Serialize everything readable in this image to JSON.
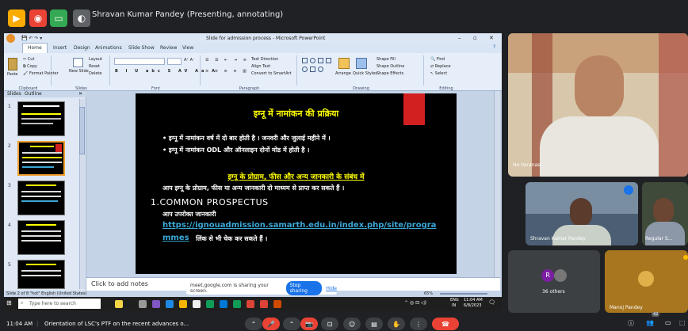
{
  "meet_top": {
    "presenter_status": "Shravan Kumar Pandey (Presenting, annotating)"
  },
  "ppt": {
    "window_title": "Slide for admission process - Microsoft PowerPoint",
    "tabs": [
      "Home",
      "Insert",
      "Design",
      "Animations",
      "Slide Show",
      "Review",
      "View"
    ],
    "ribbon": {
      "paste": "Paste",
      "cut": "Cut",
      "copy": "Copy",
      "format_painter": "Format Painter",
      "new_slide": "New Slide",
      "layout": "Layout",
      "reset": "Reset",
      "delete": "Delete",
      "text_direction": "Text Direction",
      "align_text": "Align Text",
      "convert_smartart": "Convert to SmartArt",
      "arrange": "Arrange",
      "quick_styles": "Quick Styles",
      "shape_fill": "Shape Fill",
      "shape_outline": "Shape Outline",
      "shape_effects": "Shape Effects",
      "find": "Find",
      "replace": "Replace",
      "select": "Select",
      "groups": {
        "clipboard": "Clipboard",
        "slides": "Slides",
        "font": "Font",
        "paragraph": "Paragraph",
        "drawing": "Drawing",
        "editing": "Editing"
      }
    },
    "pane_tabs": {
      "slides": "Slides",
      "outline": "Outline"
    },
    "thumb_numbers": [
      "1",
      "2",
      "3",
      "4",
      "5"
    ],
    "slide": {
      "heading1": "इग्नू में नामांकन की प्रक्रिया",
      "bullet1": "• इग्नू में नामांकन वर्ष में दो बार होती है । जनवरी और जुलाई महीने में ।",
      "bullet2": "• इग्नू में नामांकन ODL और ऑनलाइन दोनों मोड में होती है ।",
      "heading2": "इग्नू के प्रोग्राम, फीस और अन्य जानकारी के संबंध में",
      "para": "आप इग्नू के प्रोग्राम, फीस या अन्य जानकारी दो माध्यम से प्राप्त कर सकते हैं ।",
      "item1": "1.COMMON PROSPECTUS",
      "item1_sub": "आप उपरोक्त जानकारी",
      "url_line1": "https://ignouadmission.samarth.edu.in/index.php/site/progra",
      "url_line2": "mmes",
      "url_suffix": "लिंक से भी चेक कर सकते हैं ।",
      "colors": {
        "bg": "#000000",
        "yellow": "#ffff00",
        "red": "#d21f1f",
        "link": "#3aa7d6",
        "text": "#ffffff"
      }
    },
    "notes_placeholder": "Click to add notes",
    "status_left": "Slide 2 of 8   \"hot\"   English (United States)",
    "zoom": "65%"
  },
  "share_banner": {
    "text": "meet.google.com is sharing your screen.",
    "stop": "Stop sharing",
    "hide": "Hide"
  },
  "taskbar": {
    "search_placeholder": "Type here to search",
    "lang": "ENG",
    "lang_sub": "IN",
    "time": "11:04 AM",
    "date": "6/8/2023"
  },
  "participants": {
    "main_location": "Ho Varanasi",
    "tile1_name": "Shravan Kumar Pandey",
    "tile2_name": "Regular S...",
    "others_count": "36 others",
    "others_initial": "R",
    "manoj_name": "Manoj Pandey",
    "badge_count": "42"
  },
  "bottom": {
    "time": "11:04 AM",
    "meeting_title": "Orientation of LSC's PTF on the recent advances o..."
  }
}
